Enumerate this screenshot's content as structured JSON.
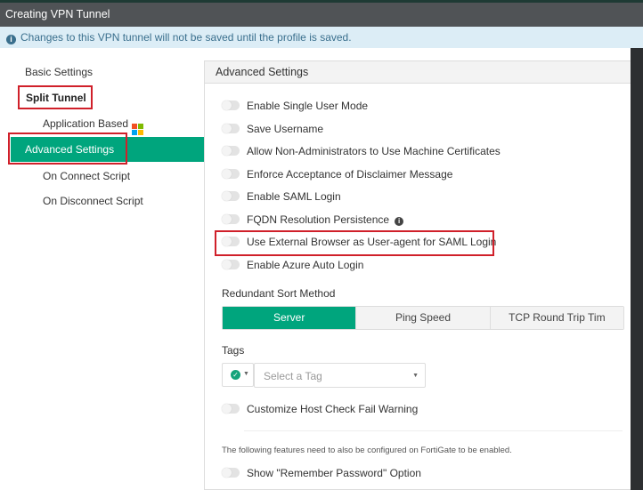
{
  "title": "Creating VPN Tunnel",
  "info": "Changes to this VPN tunnel will not be saved until the profile is saved.",
  "nav": {
    "basic": "Basic Settings",
    "split": "Split Tunnel",
    "app": "Application Based",
    "advanced": "Advanced Settings",
    "connect": "On Connect Script",
    "disconnect": "On Disconnect Script"
  },
  "panel": {
    "header": "Advanced Settings",
    "toggles": [
      "Enable Single User Mode",
      "Save Username",
      "Allow Non-Administrators to Use Machine Certificates",
      "Enforce Acceptance of Disclaimer Message",
      "Enable SAML Login",
      "FQDN Resolution Persistence",
      "Use External Browser as User-agent for SAML Login",
      "Enable Azure Auto Login"
    ],
    "sort_label": "Redundant Sort Method",
    "sort_options": [
      "Server",
      "Ping Speed",
      "TCP Round Trip Tim"
    ],
    "tags_label": "Tags",
    "tag_placeholder": "Select a Tag",
    "customize": "Customize Host Check Fail Warning",
    "note": "The following features need to also be configured on FortiGate to be enabled.",
    "remember": "Show \"Remember Password\" Option"
  },
  "colors": {
    "accent": "#00a57d",
    "highlight": "#d0202a"
  }
}
